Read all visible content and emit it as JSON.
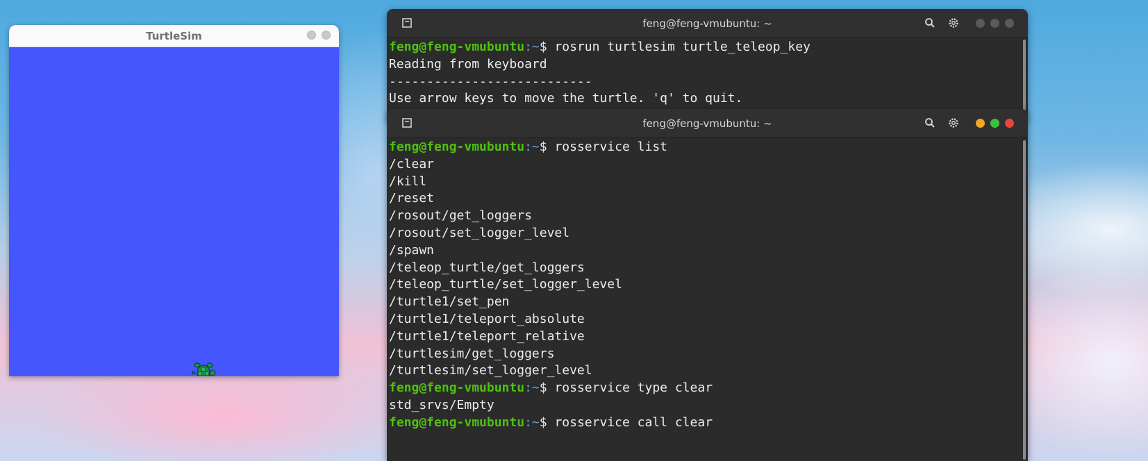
{
  "turtlesim": {
    "title": "TurtleSim",
    "background_color": "#4556ff"
  },
  "terminal_back": {
    "title": "feng@feng-vmubuntu: ~",
    "lines": [
      {
        "user": "feng@feng-vmubuntu",
        "path": ":~",
        "prompt": "$ ",
        "cmd": "rosrun turtlesim turtle_teleop_key"
      },
      {
        "text": "Reading from keyboard"
      },
      {
        "text": "---------------------------"
      },
      {
        "text": "Use arrow keys to move the turtle. 'q' to quit."
      }
    ]
  },
  "terminal_front": {
    "title": "feng@feng-vmubuntu: ~",
    "lines": [
      {
        "user": "feng@feng-vmubuntu",
        "path": ":~",
        "prompt": "$ ",
        "cmd": "rosservice list"
      },
      {
        "text": "/clear"
      },
      {
        "text": "/kill"
      },
      {
        "text": "/reset"
      },
      {
        "text": "/rosout/get_loggers"
      },
      {
        "text": "/rosout/set_logger_level"
      },
      {
        "text": "/spawn"
      },
      {
        "text": "/teleop_turtle/get_loggers"
      },
      {
        "text": "/teleop_turtle/set_logger_level"
      },
      {
        "text": "/turtle1/set_pen"
      },
      {
        "text": "/turtle1/teleport_absolute"
      },
      {
        "text": "/turtle1/teleport_relative"
      },
      {
        "text": "/turtlesim/get_loggers"
      },
      {
        "text": "/turtlesim/set_logger_level"
      },
      {
        "user": "feng@feng-vmubuntu",
        "path": ":~",
        "prompt": "$ ",
        "cmd": "rosservice type clear"
      },
      {
        "text": "std_srvs/Empty"
      },
      {
        "user": "feng@feng-vmubuntu",
        "path": ":~",
        "prompt": "$ ",
        "cmd": "rosservice call clear"
      }
    ]
  },
  "icons": {
    "new_tab": "new-tab-icon",
    "search": "search-icon",
    "settings": "gear-icon"
  },
  "colors": {
    "prompt_user": "#4ec10d",
    "prompt_path": "#6aa0df",
    "minimize": "#f5a623",
    "maximize": "#3fbf3f",
    "close": "#e8453c",
    "inactive_control": "#5a5a5a"
  }
}
